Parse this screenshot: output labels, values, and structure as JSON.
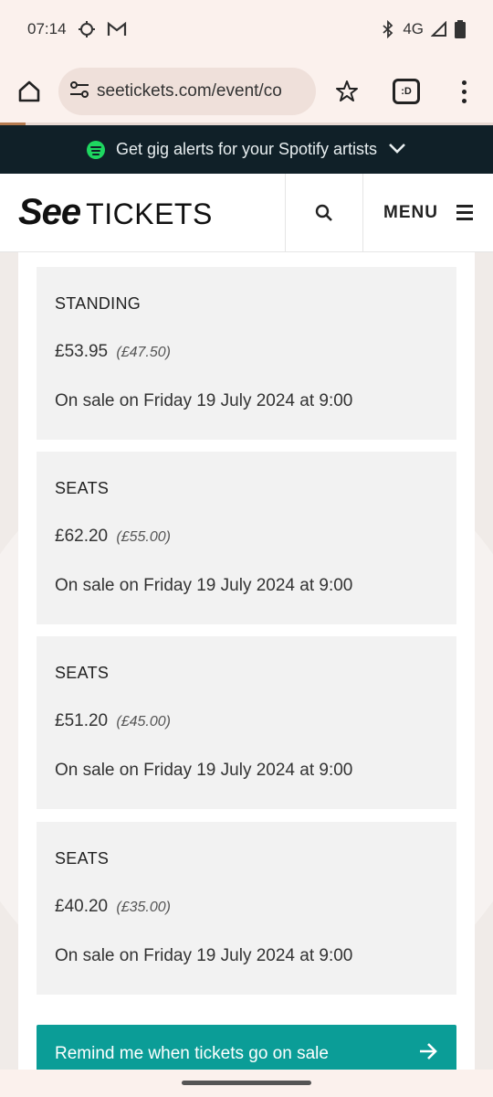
{
  "status_bar": {
    "time": "07:14",
    "network": "4G",
    "icons": [
      "location-icon",
      "gmail-icon",
      "bluetooth-icon",
      "signal-icon",
      "battery-icon"
    ]
  },
  "browser": {
    "url": "seetickets.com/event/co",
    "icons": [
      "home-icon",
      "site-settings-icon",
      "star-icon",
      "tab-switcher-icon",
      "overflow-menu-icon"
    ],
    "tab_label": ":D"
  },
  "banner": {
    "text": "Get gig alerts for your Spotify artists",
    "accent": "#1ed760",
    "background": "#102028"
  },
  "header": {
    "logo_see": "See",
    "logo_tickets": "TICKETS",
    "menu_label": "MENU"
  },
  "tickets": [
    {
      "type": "STANDING",
      "price": "£53.95",
      "base_price": "(£47.50)",
      "sale_info": "On sale on Friday 19 July 2024 at 9:00"
    },
    {
      "type": "SEATS",
      "price": "£62.20",
      "base_price": "(£55.00)",
      "sale_info": "On sale on Friday 19 July 2024 at 9:00"
    },
    {
      "type": "SEATS",
      "price": "£51.20",
      "base_price": "(£45.00)",
      "sale_info": "On sale on Friday 19 July 2024 at 9:00"
    },
    {
      "type": "SEATS",
      "price": "£40.20",
      "base_price": "(£35.00)",
      "sale_info": "On sale on Friday 19 July 2024 at 9:00"
    }
  ],
  "remind_button": {
    "label": "Remind me when tickets go on sale",
    "color": "#0b9d97"
  }
}
